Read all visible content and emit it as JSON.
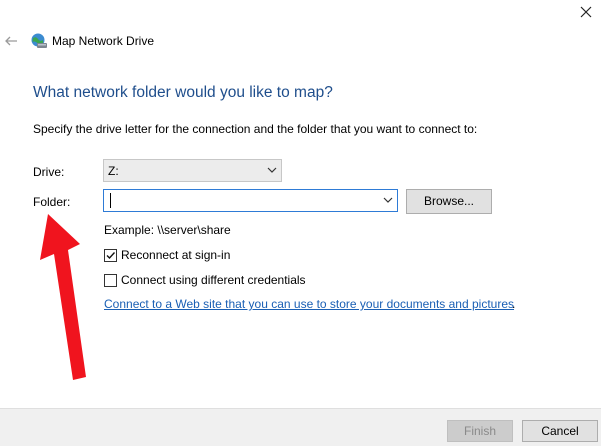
{
  "window": {
    "title": "Map Network Drive",
    "close_icon": "close-icon",
    "back_icon": "back-arrow-icon",
    "app_icon": "network-drive-icon"
  },
  "main": {
    "heading": "What network folder would you like to map?",
    "instruction": "Specify the drive letter for the connection and the folder that you want to connect to:",
    "drive": {
      "label": "Drive:",
      "value": "Z:"
    },
    "folder": {
      "label": "Folder:",
      "value": ""
    },
    "browse_label": "Browse...",
    "example": "Example: \\\\server\\share",
    "reconnect": {
      "label": "Reconnect at sign-in",
      "checked": true
    },
    "different_credentials": {
      "label": "Connect using different credentials",
      "checked": false
    },
    "web_link": "Connect to a Web site that you can use to store your documents and pictures",
    "web_link_suffix": "."
  },
  "footer": {
    "finish_label": "Finish",
    "cancel_label": "Cancel"
  },
  "colors": {
    "heading": "#1f4e8c",
    "link": "#1a5fb4",
    "annotation_arrow": "#f0141e",
    "footer_bg": "#f0f0f0"
  }
}
